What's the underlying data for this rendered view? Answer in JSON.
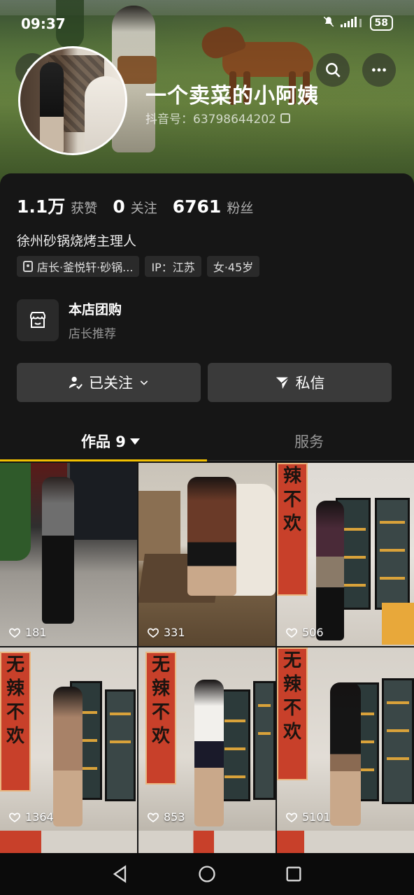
{
  "status_bar": {
    "time": "09:37",
    "battery": "58"
  },
  "profile": {
    "nickname": "一个卖菜的小阿姨",
    "douyin_id": "抖音号：63798644202",
    "stats": [
      {
        "value": "1.1万",
        "label": "获赞"
      },
      {
        "value": "0",
        "label": "关注"
      },
      {
        "value": "6761",
        "label": "粉丝"
      }
    ],
    "bio": "徐州砂锅烧烤主理人",
    "tags": [
      {
        "text": "店长·釜悦轩·砂锅...",
        "icon": "shop-icon"
      },
      {
        "text": "IP：江苏"
      },
      {
        "text": "女·45岁"
      }
    ],
    "group_buy": {
      "title": "本店团购",
      "subtitle": "店长推荐",
      "icon": "store-icon"
    },
    "buttons": {
      "followed": "已关注",
      "message": "私信"
    },
    "tabs": {
      "works": "作品 9",
      "service": "服务"
    }
  },
  "videos": [
    {
      "likes": "181"
    },
    {
      "likes": "331"
    },
    {
      "likes": "506"
    },
    {
      "likes": "1364"
    },
    {
      "likes": "853"
    },
    {
      "likes": "5101"
    }
  ],
  "colors": {
    "background": "#161616",
    "tab_indicator": "#f2c000",
    "button_bg": "#3a3a3a"
  }
}
